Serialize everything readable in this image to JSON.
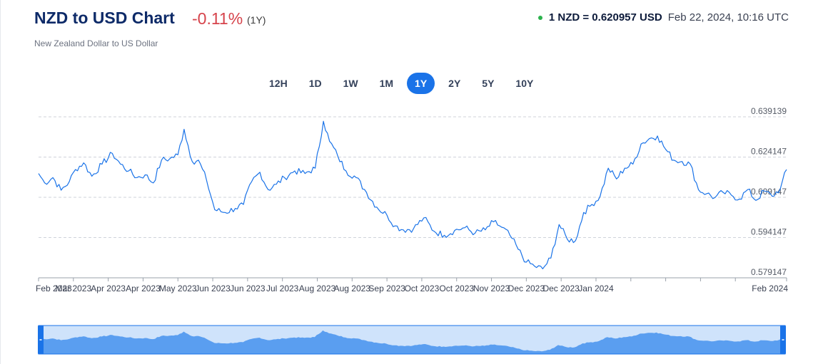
{
  "header": {
    "title": "NZD to USD Chart",
    "change": "-0.11%",
    "period": "(1Y)",
    "subtitle": "New Zealand Dollar to US Dollar",
    "rate": "1 NZD = 0.620957 USD",
    "timestamp": "Feb 22, 2024, 10:16 UTC"
  },
  "ranges": [
    {
      "label": "12H",
      "active": false
    },
    {
      "label": "1D",
      "active": false
    },
    {
      "label": "1W",
      "active": false
    },
    {
      "label": "1M",
      "active": false
    },
    {
      "label": "1Y",
      "active": true
    },
    {
      "label": "2Y",
      "active": false
    },
    {
      "label": "5Y",
      "active": false
    },
    {
      "label": "10Y",
      "active": false
    }
  ],
  "colors": {
    "line": "#1a73e8",
    "title": "#0d2a68",
    "change": "#d6434b",
    "status_dot": "#2bb24c",
    "navigator_fill": "#5a9ef0",
    "navigator_bg": "#cfe3fb",
    "navigator_handle": "#1a73e8"
  },
  "chart_data": {
    "type": "line",
    "title": "",
    "xlabel": "",
    "ylabel": "",
    "grid": true,
    "ylim": [
      0.579147,
      0.639139
    ],
    "y_ticks": [
      0.639139,
      0.624147,
      0.609147,
      0.594147,
      0.579147
    ],
    "y_tick_labels": [
      "0.639139",
      "0.624147",
      "0.609147",
      "0.594147",
      "0.579147"
    ],
    "x_ticks": [
      "2023-02-22",
      "2023-03-11",
      "2023-03-28",
      "2023-04-14",
      "2023-05-01",
      "2023-05-18",
      "2023-06-04",
      "2023-06-21",
      "2023-07-08",
      "2023-07-25",
      "2023-08-11",
      "2023-08-28",
      "2023-09-14",
      "2023-10-01",
      "2023-10-18",
      "2023-11-04",
      "2023-11-21",
      "2023-12-08",
      "2023-12-25",
      "2024-01-11",
      "2024-01-28",
      "2024-02-22"
    ],
    "x_tick_labels": [
      "Feb 2023",
      "Mar 2023",
      "Apr 2023",
      "Apr 2023",
      "May 2023",
      "Jun 2023",
      "Jun 2023",
      "Jul 2023",
      "Aug 2023",
      "Aug 2023",
      "Sep 2023",
      "Oct 2023",
      "Oct 2023",
      "Nov 2023",
      "Dec 2023",
      "Dec 2023",
      "Jan 2024",
      "",
      "",
      "",
      "",
      "Feb 2024"
    ],
    "series": [
      {
        "x": [
          "2023-02-22",
          "2023-02-25",
          "2023-03-01",
          "2023-03-05",
          "2023-03-09",
          "2023-03-12",
          "2023-03-16",
          "2023-03-20",
          "2023-03-25",
          "2023-03-30",
          "2023-04-03",
          "2023-04-07",
          "2023-04-11",
          "2023-04-15",
          "2023-04-19",
          "2023-04-23",
          "2023-04-27",
          "2023-05-01",
          "2023-05-04",
          "2023-05-08",
          "2023-05-11",
          "2023-05-15",
          "2023-05-19",
          "2023-05-24",
          "2023-05-29",
          "2023-06-02",
          "2023-06-06",
          "2023-06-10",
          "2023-06-14",
          "2023-06-18",
          "2023-06-22",
          "2023-06-27",
          "2023-07-02",
          "2023-07-07",
          "2023-07-11",
          "2023-07-14",
          "2023-07-18",
          "2023-07-22",
          "2023-07-27",
          "2023-08-01",
          "2023-08-06",
          "2023-08-11",
          "2023-08-15",
          "2023-08-19",
          "2023-08-24",
          "2023-08-29",
          "2023-09-03",
          "2023-09-08",
          "2023-09-13",
          "2023-09-18",
          "2023-09-23",
          "2023-09-28",
          "2023-10-02",
          "2023-10-06",
          "2023-10-10",
          "2023-10-14",
          "2023-10-18",
          "2023-10-22",
          "2023-10-26",
          "2023-10-30",
          "2023-11-03",
          "2023-11-07",
          "2023-11-11",
          "2023-11-15",
          "2023-11-19",
          "2023-11-23",
          "2023-11-27",
          "2023-12-01",
          "2023-12-05",
          "2023-12-09",
          "2023-12-13",
          "2023-12-17",
          "2023-12-21",
          "2023-12-25",
          "2023-12-29",
          "2024-01-02",
          "2024-01-06",
          "2024-01-10",
          "2024-01-14",
          "2024-01-18",
          "2024-01-22",
          "2024-01-26",
          "2024-01-30",
          "2024-02-03",
          "2024-02-07",
          "2024-02-11",
          "2024-02-15",
          "2024-02-19",
          "2024-02-22"
        ],
        "values": [
          0.618,
          0.6145,
          0.6165,
          0.6118,
          0.615,
          0.6195,
          0.622,
          0.617,
          0.6215,
          0.6255,
          0.6215,
          0.619,
          0.6165,
          0.6175,
          0.6145,
          0.623,
          0.6235,
          0.625,
          0.6345,
          0.6225,
          0.623,
          0.6155,
          0.6045,
          0.6035,
          0.605,
          0.6065,
          0.615,
          0.6185,
          0.612,
          0.614,
          0.6165,
          0.619,
          0.618,
          0.62,
          0.6375,
          0.63,
          0.6245,
          0.619,
          0.6165,
          0.611,
          0.6055,
          0.6025,
          0.5985,
          0.597,
          0.5975,
          0.6015,
          0.5965,
          0.595,
          0.5968,
          0.5978,
          0.5958,
          0.597,
          0.6,
          0.598,
          0.595,
          0.5898,
          0.585,
          0.5835,
          0.5825,
          0.5865,
          0.599,
          0.5935,
          0.593,
          0.6035,
          0.6065,
          0.6095,
          0.62,
          0.616,
          0.62,
          0.6215,
          0.629,
          0.631,
          0.632,
          0.627,
          0.623,
          0.6225,
          0.6215,
          0.612,
          0.6105,
          0.609,
          0.611,
          0.61,
          0.6085,
          0.612,
          0.608,
          0.6115,
          0.6095,
          0.6125,
          0.6195
        ]
      }
    ]
  }
}
